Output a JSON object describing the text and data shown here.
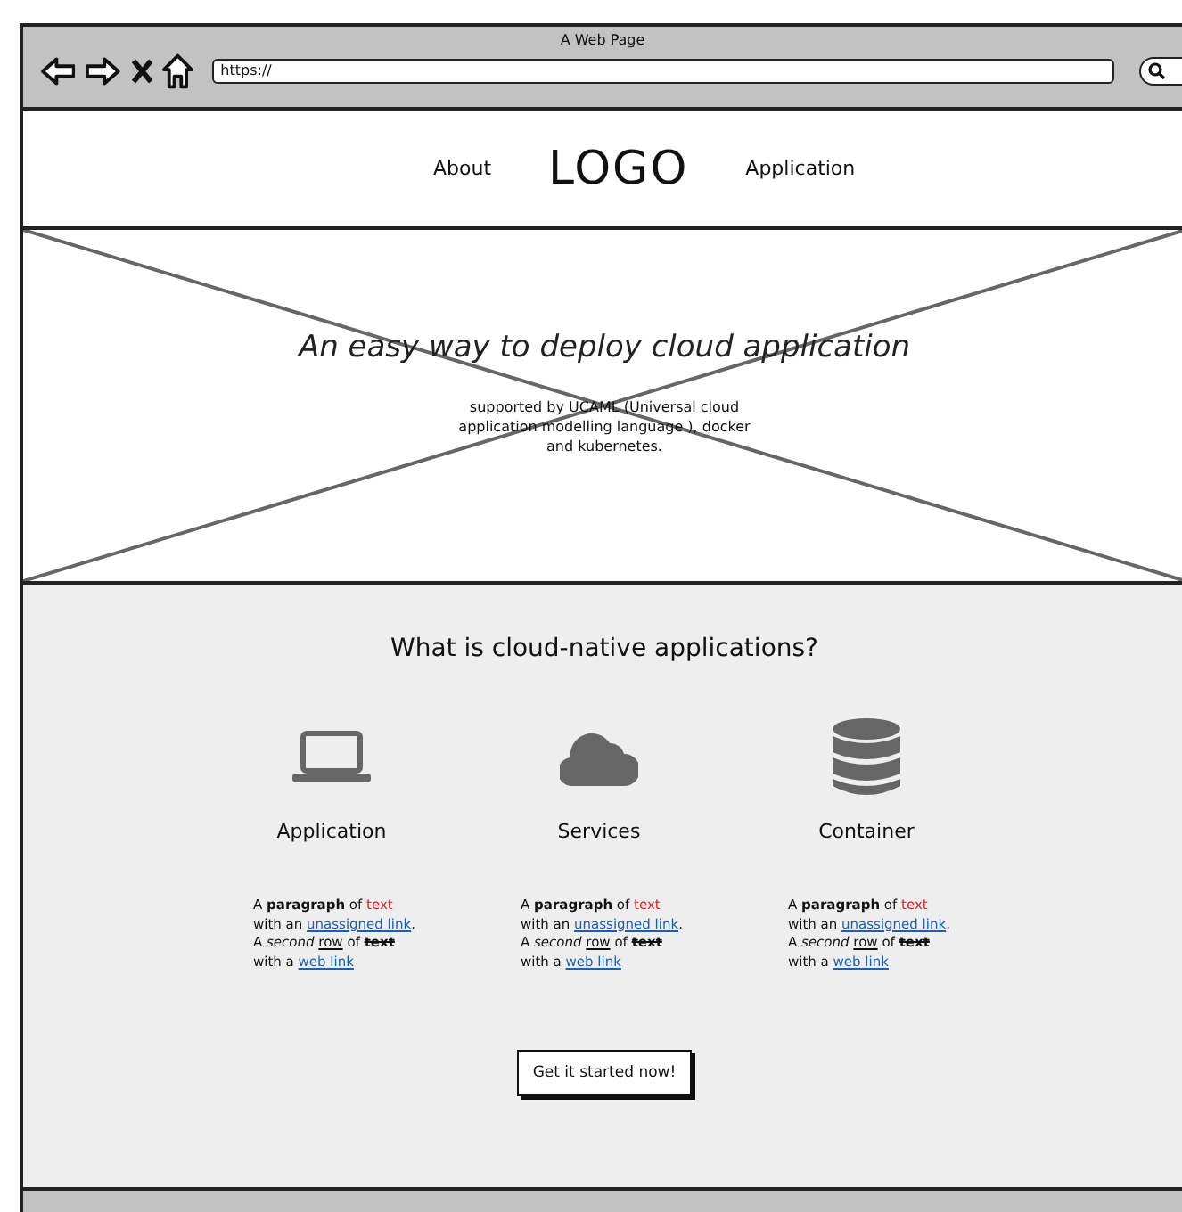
{
  "window": {
    "title": "A Web Page"
  },
  "browser": {
    "url": "https://"
  },
  "nav": {
    "links": [
      {
        "label": "About"
      },
      {
        "label": "Application"
      }
    ],
    "logo": "LOGO"
  },
  "hero": {
    "title": "An easy way to deploy cloud application",
    "subtitle": "supported by UCAML (Universal cloud application modelling language ), docker and kubernetes."
  },
  "section": {
    "title": "What is cloud-native applications?",
    "columns": [
      {
        "kind": "laptop",
        "title": "Application",
        "paragraph": [
          [
            {
              "text": "A ",
              "kind": "plain"
            },
            {
              "text": "paragraph",
              "kind": "bold"
            },
            {
              "text": " of ",
              "kind": "plain"
            },
            {
              "text": "text",
              "kind": "red"
            }
          ],
          [
            {
              "text": "with an ",
              "kind": "plain"
            },
            {
              "text": "unassigned link",
              "kind": "link"
            },
            {
              "text": ".",
              "kind": "plain"
            }
          ],
          [
            {
              "text": "A ",
              "kind": "plain"
            },
            {
              "text": "second ",
              "kind": "italic"
            },
            {
              "text": "row",
              "kind": "underline"
            },
            {
              "text": " of ",
              "kind": "plain"
            },
            {
              "text": "text",
              "kind": "strike"
            }
          ],
          [
            {
              "text": "with a ",
              "kind": "plain"
            },
            {
              "text": "web link",
              "kind": "link"
            }
          ]
        ]
      },
      {
        "kind": "cloud",
        "title": "Services",
        "paragraph": [
          [
            {
              "text": "A ",
              "kind": "plain"
            },
            {
              "text": "paragraph",
              "kind": "bold"
            },
            {
              "text": " of ",
              "kind": "plain"
            },
            {
              "text": "text",
              "kind": "red"
            }
          ],
          [
            {
              "text": "with an ",
              "kind": "plain"
            },
            {
              "text": "unassigned link",
              "kind": "link"
            },
            {
              "text": ".",
              "kind": "plain"
            }
          ],
          [
            {
              "text": "A ",
              "kind": "plain"
            },
            {
              "text": "second ",
              "kind": "italic"
            },
            {
              "text": "row",
              "kind": "underline"
            },
            {
              "text": " of ",
              "kind": "plain"
            },
            {
              "text": "text",
              "kind": "strike"
            }
          ],
          [
            {
              "text": "with a ",
              "kind": "plain"
            },
            {
              "text": "web link",
              "kind": "link"
            }
          ]
        ]
      },
      {
        "kind": "database",
        "title": "Container",
        "paragraph": [
          [
            {
              "text": "A ",
              "kind": "plain"
            },
            {
              "text": "paragraph",
              "kind": "bold"
            },
            {
              "text": " of ",
              "kind": "plain"
            },
            {
              "text": "text",
              "kind": "red"
            }
          ],
          [
            {
              "text": "with an ",
              "kind": "plain"
            },
            {
              "text": "unassigned link",
              "kind": "link"
            },
            {
              "text": ".",
              "kind": "plain"
            }
          ],
          [
            {
              "text": "A ",
              "kind": "plain"
            },
            {
              "text": "second ",
              "kind": "italic"
            },
            {
              "text": "row",
              "kind": "underline"
            },
            {
              "text": " of ",
              "kind": "plain"
            },
            {
              "text": "text",
              "kind": "strike"
            }
          ],
          [
            {
              "text": "with a ",
              "kind": "plain"
            },
            {
              "text": "web link",
              "kind": "link"
            }
          ]
        ]
      }
    ],
    "button": "Get it started now!"
  }
}
